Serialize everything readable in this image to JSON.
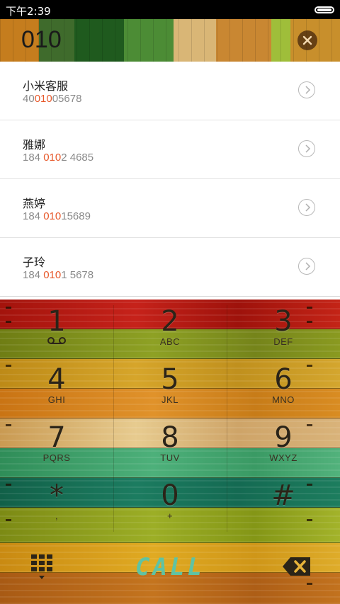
{
  "status": {
    "time": "下午2:39"
  },
  "search": {
    "query": "010"
  },
  "results": [
    {
      "name": "小米客服",
      "num_pre": "40",
      "num_hl": "010",
      "num_post": "05678"
    },
    {
      "name": "雅娜",
      "num_pre": "184 ",
      "num_hl": "010",
      "num_post": "2 4685"
    },
    {
      "name": "燕婷",
      "num_pre": "184 ",
      "num_hl": "010",
      "num_post": "15689"
    },
    {
      "name": "子玲",
      "num_pre": "184 ",
      "num_hl": "010",
      "num_post": "1 5678"
    }
  ],
  "keypad": {
    "k1": {
      "digit": "1",
      "letters": ""
    },
    "k2": {
      "digit": "2",
      "letters": "ABC"
    },
    "k3": {
      "digit": "3",
      "letters": "DEF"
    },
    "k4": {
      "digit": "4",
      "letters": "GHI"
    },
    "k5": {
      "digit": "5",
      "letters": "JKL"
    },
    "k6": {
      "digit": "6",
      "letters": "MNO"
    },
    "k7": {
      "digit": "7",
      "letters": "PQRS"
    },
    "k8": {
      "digit": "8",
      "letters": "TUV"
    },
    "k9": {
      "digit": "9",
      "letters": "WXYZ"
    },
    "kstar": {
      "digit": "*",
      "letters": ","
    },
    "k0": {
      "digit": "0",
      "letters": "+"
    },
    "khash": {
      "digit": "#",
      "letters": ""
    }
  },
  "actions": {
    "call_label": "CALL"
  },
  "colors": {
    "highlight": "#e7582a",
    "call_text": "#5fc3a3"
  },
  "icons": [
    "battery-icon",
    "clear-icon",
    "chevron-right-icon",
    "voicemail-icon",
    "keypad-grid-icon",
    "backspace-icon"
  ]
}
